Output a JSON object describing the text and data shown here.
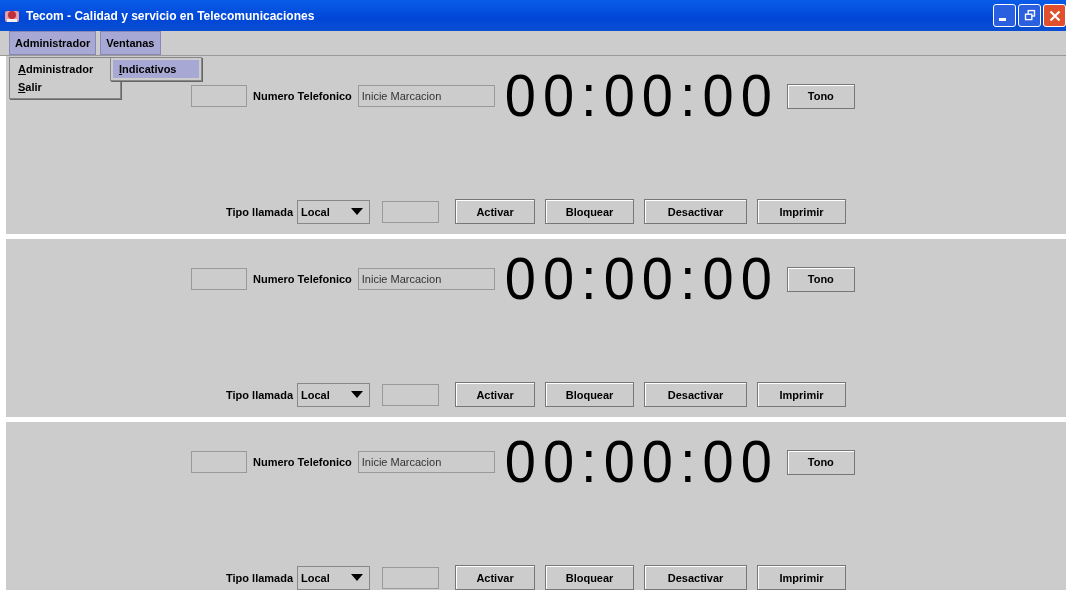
{
  "window": {
    "title": "Tecom - Calidad y servicio en Telecomunicaciones"
  },
  "menu_bar": [
    {
      "label": "Administrador",
      "selected": true,
      "items": [
        {
          "label": "Administrador",
          "selected": false
        },
        {
          "label": "Salir",
          "selected": false
        }
      ]
    },
    {
      "label": "Ventanas",
      "selected": true,
      "items": [
        {
          "label": "Indicativos",
          "selected": true
        }
      ]
    }
  ],
  "lines": [
    {
      "phone_label": "Numero Telefonico",
      "phone_value": "Inicie Marcacion",
      "timer": "00:00:00",
      "tone_button": "Tono",
      "type_label": "Tipo llamada",
      "type_value": "Local",
      "buttons": [
        "Activar",
        "Bloquear",
        "Desactivar",
        "Imprimir"
      ]
    },
    {
      "phone_label": "Numero Telefonico",
      "phone_value": "Inicie Marcacion",
      "timer": "00:00:00",
      "tone_button": "Tono",
      "type_label": "Tipo llamada",
      "type_value": "Local",
      "buttons": [
        "Activar",
        "Bloquear",
        "Desactivar",
        "Imprimir"
      ]
    },
    {
      "phone_label": "Numero Telefonico",
      "phone_value": "Inicie Marcacion",
      "timer": "00:00:00",
      "tone_button": "Tono",
      "type_label": "Tipo llamada",
      "type_value": "Local",
      "buttons": [
        "Activar",
        "Bloquear",
        "Desactivar",
        "Imprimir"
      ]
    }
  ]
}
